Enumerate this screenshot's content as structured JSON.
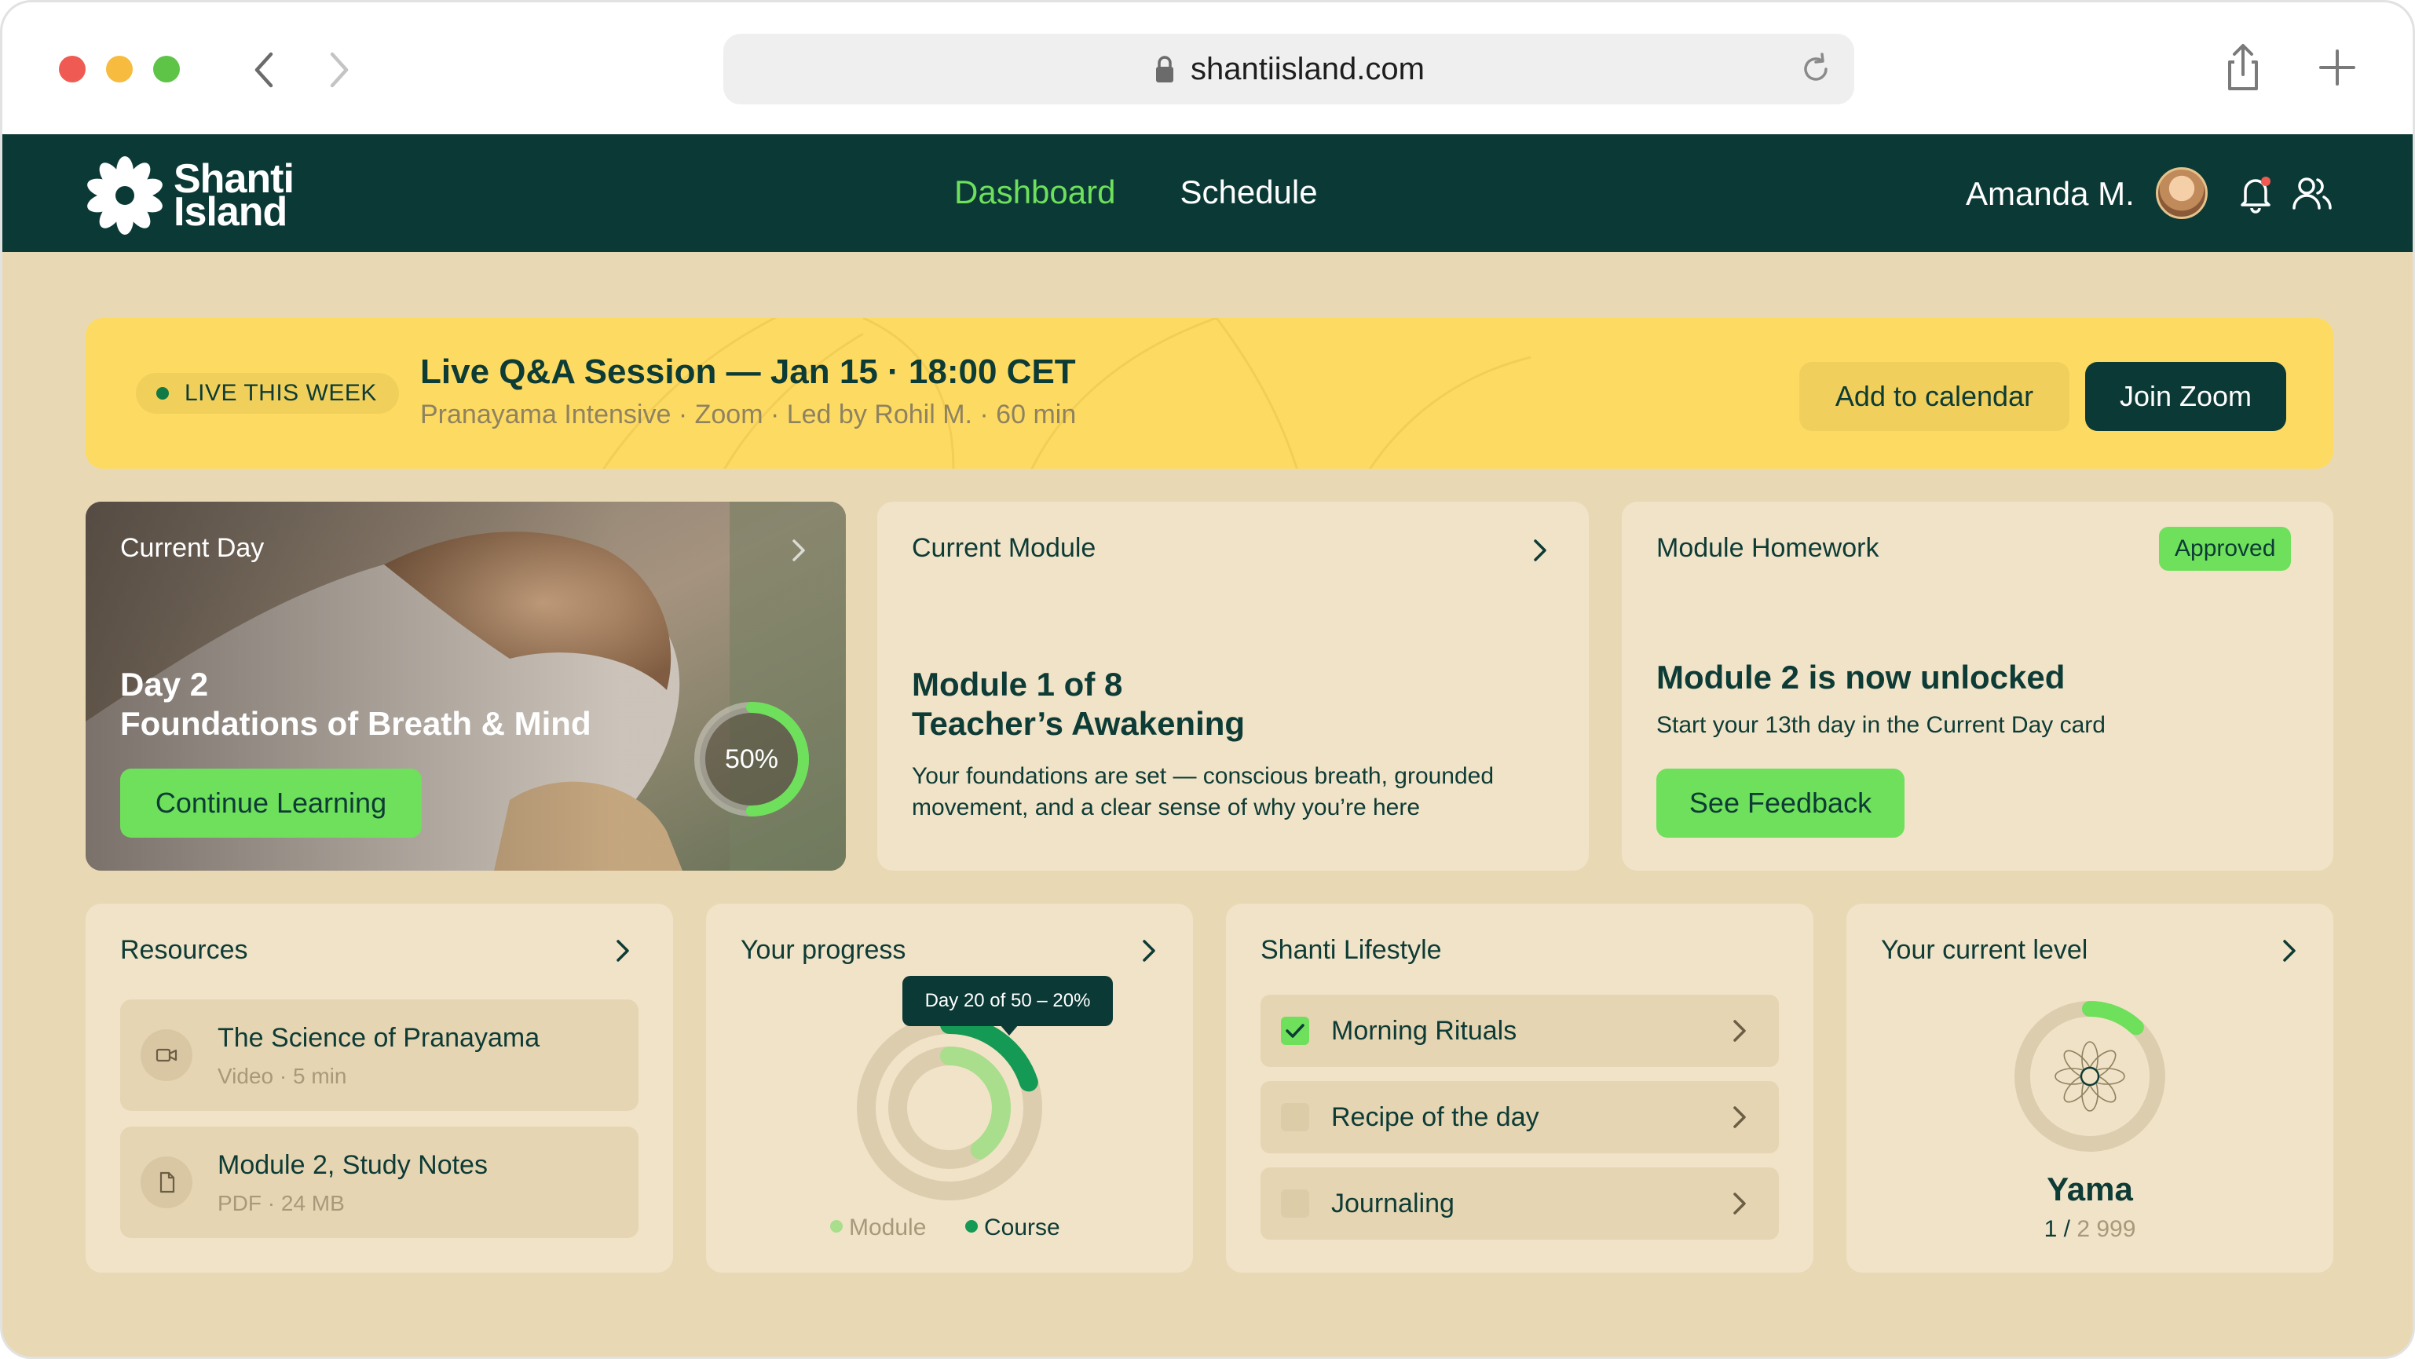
{
  "browser": {
    "url": "shantiisland.com",
    "icons": [
      "back-icon",
      "forward-icon",
      "lock-icon",
      "reload-icon",
      "share-icon",
      "plus-icon"
    ]
  },
  "header": {
    "logo_line1": "Shanti",
    "logo_line2": "Island",
    "nav": [
      {
        "label": "Dashboard",
        "active": true
      },
      {
        "label": "Schedule",
        "active": false
      }
    ],
    "user_name": "Amanda M."
  },
  "banner": {
    "badge": "LIVE THIS WEEK",
    "title": "Live Q&A Session — Jan 15 · 18:00 CET",
    "subtitle": "Pranayama Intensive · Zoom · Led by Rohil M. · 60 min",
    "add_calendar": "Add to calendar",
    "join_zoom": "Join Zoom"
  },
  "current_day": {
    "label": "Current Day",
    "day": "Day 2",
    "title": "Foundations of Breath & Mind",
    "button": "Continue Learning",
    "progress_text": "50%",
    "progress": 0.5
  },
  "current_module": {
    "label": "Current Module",
    "line1": "Module 1 of 8",
    "line2": "Teacher’s Awakening",
    "desc_line1": "Your foundations are set — conscious breath, grounded",
    "desc_line2": "movement, and a clear sense of why you’re here"
  },
  "homework": {
    "label": "Module Homework",
    "badge": "Approved",
    "title": "Module 2 is now unlocked",
    "subtitle": "Start your 13th day in the Current Day card",
    "button": "See Feedback"
  },
  "resources": {
    "label": "Resources",
    "items": [
      {
        "name": "The Science of Pranayama",
        "meta": "Video · 5 min"
      },
      {
        "name": "Module 2, Study Notes",
        "meta": "PDF · 24 MB"
      }
    ]
  },
  "progress": {
    "label": "Your progress",
    "tooltip": "Day 20 of 50 – 20%",
    "legend": [
      "Module",
      "Course"
    ],
    "course_fraction": 0.2,
    "module_fraction": 0.4
  },
  "lifestyle": {
    "label": "Shanti Lifestyle",
    "items": [
      {
        "label": "Morning Rituals",
        "checked": true
      },
      {
        "label": "Recipe of the day",
        "checked": false
      },
      {
        "label": "Journaling",
        "checked": false
      }
    ]
  },
  "level": {
    "label": "Your current level",
    "name": "Yama",
    "current": "1",
    "separator": " / ",
    "total": "2 999",
    "fraction": 0.12
  },
  "colors": {
    "accent_green": "#6ee05b",
    "dark_green": "#0b3a36",
    "banner_yellow": "#fddb63",
    "page_bg": "#e9d8b4",
    "card_bg": "#f1e3c8",
    "course_green": "#149a55",
    "module_green": "#a8de8c"
  }
}
